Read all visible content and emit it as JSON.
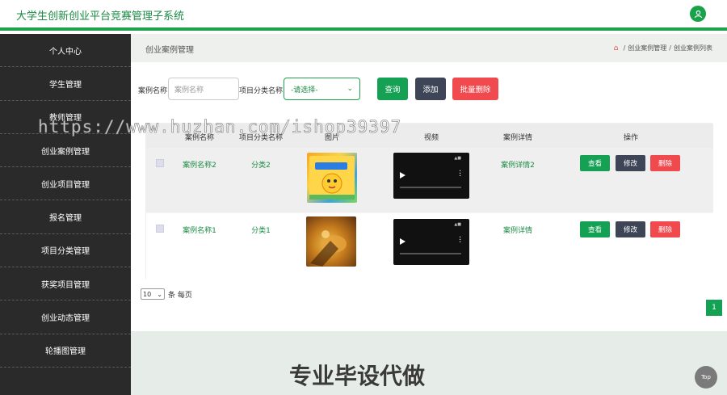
{
  "header": {
    "title": "大学生创新创业平台竞赛管理子系统",
    "avatar_icon": "user-icon"
  },
  "sidebar": {
    "items": [
      {
        "label": "个人中心"
      },
      {
        "label": "学生管理"
      },
      {
        "label": "教师管理"
      },
      {
        "label": "创业案例管理"
      },
      {
        "label": "创业项目管理"
      },
      {
        "label": "报名管理"
      },
      {
        "label": "项目分类管理"
      },
      {
        "label": "获奖项目管理"
      },
      {
        "label": "创业动态管理"
      },
      {
        "label": "轮播图管理"
      }
    ]
  },
  "page": {
    "title": "创业案例管理",
    "breadcrumb": [
      "创业案例管理",
      "创业案例列表"
    ]
  },
  "search": {
    "name_label": "案例名称",
    "name_placeholder": "案例名称",
    "category_label": "项目分类名称",
    "category_value": "-请选择-",
    "query_btn": "查询",
    "add_btn": "添加",
    "batch_delete_btn": "批量删除"
  },
  "table": {
    "headers": [
      "案例名称",
      "项目分类名称",
      "图片",
      "视频",
      "案例详情",
      "操作"
    ],
    "rows": [
      {
        "name": "案例名称2",
        "category": "分类2",
        "detail": "案例详情2"
      },
      {
        "name": "案例名称1",
        "category": "分类1",
        "detail": "案例详情"
      }
    ],
    "actions": {
      "view": "查看",
      "edit": "修改",
      "delete": "删除"
    }
  },
  "pager": {
    "page_size": "10",
    "suffix": "条 每页",
    "current_page": "1"
  },
  "footer": {
    "ad_text": "专业毕设代做",
    "top_btn": "Top"
  },
  "watermark": "https://www.huzhan.com/ishop39397",
  "colors": {
    "accent": "#14a154",
    "dark": "#3d4557",
    "danger": "#f0494e",
    "sidebar": "#2a2a2a"
  }
}
